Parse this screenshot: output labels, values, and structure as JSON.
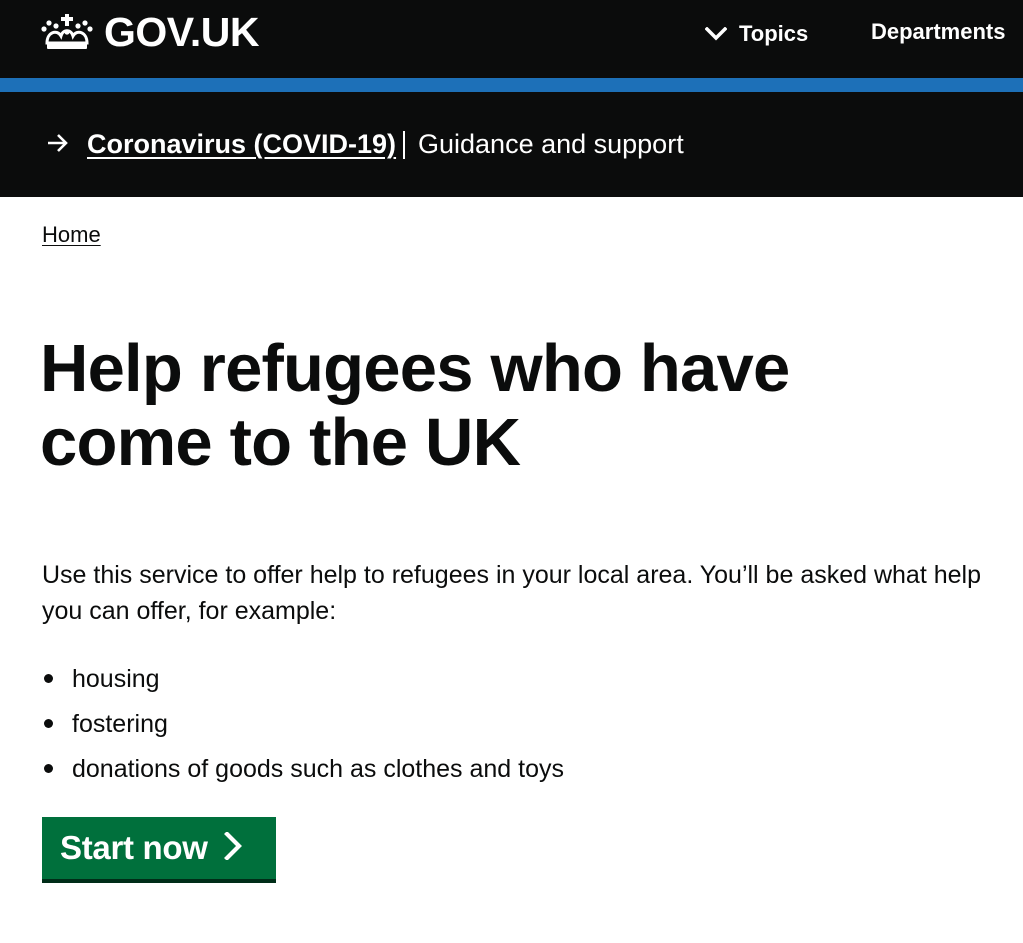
{
  "header": {
    "logo_text": "GOV.UK",
    "logo_icon": "crown-icon",
    "nav": {
      "topics_label": "Topics",
      "topics_icon": "chevron-down-icon",
      "departments_label": "Departments"
    },
    "colors": {
      "background": "#0b0c0c",
      "accent_bar": "#1d70b8"
    }
  },
  "covid_banner": {
    "arrow_icon": "arrow-right-icon",
    "link_text": "Coronavirus (COVID-19)",
    "subtitle": "Guidance and support"
  },
  "breadcrumb": {
    "home_label": "Home"
  },
  "main": {
    "title": "Help refugees who have come to the UK",
    "intro": "Use this service to offer help to refugees in your local area. You’ll be asked what help you can offer, for example:",
    "list_items": [
      "housing",
      "fostering",
      "donations of goods such as clothes and toys"
    ],
    "start_button": {
      "label": "Start now",
      "icon": "chevron-right-icon",
      "color": "#00703c"
    }
  }
}
